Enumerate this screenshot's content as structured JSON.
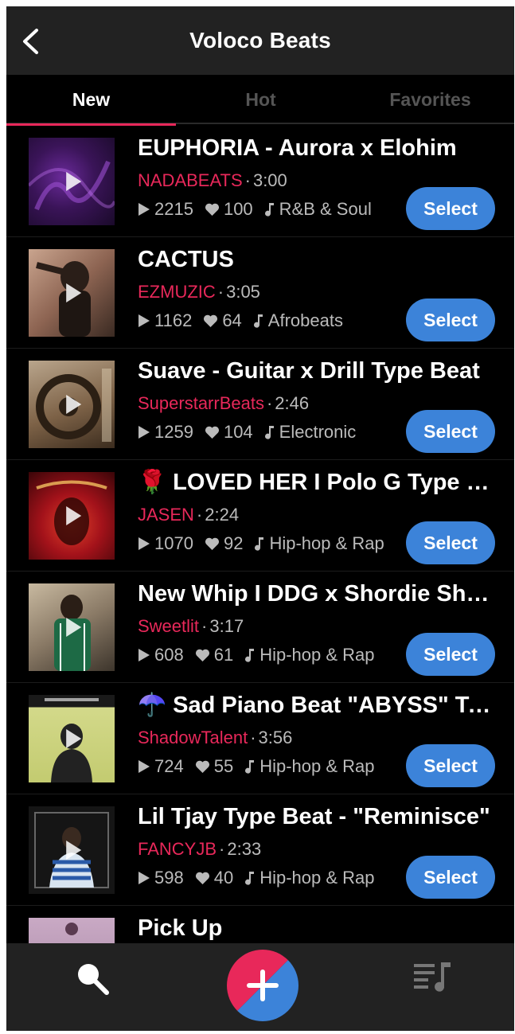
{
  "header": {
    "title": "Voloco Beats",
    "back_icon": "chevron-left-icon"
  },
  "tabs": [
    {
      "label": "New",
      "active": true
    },
    {
      "label": "Hot",
      "active": false
    },
    {
      "label": "Favorites",
      "active": false
    }
  ],
  "colors": {
    "accent": "#e8285a",
    "button": "#3c83d9",
    "bar": "#222222",
    "muted": "#bbbbbb"
  },
  "beats": [
    {
      "title": "EUPHORIA - Aurora x Elohim",
      "artist": "NADABEATS",
      "sep": "·",
      "duration": "3:00",
      "plays": "2215",
      "likes": "100",
      "genre": "R&B & Soul",
      "select_label": "Select"
    },
    {
      "title": "CACTUS",
      "artist": "EZMUZIC",
      "sep": "·",
      "duration": "3:05",
      "plays": "1162",
      "likes": "64",
      "genre": "Afrobeats",
      "select_label": "Select"
    },
    {
      "title": "Suave - Guitar x Drill Type Beat",
      "artist": "SuperstarrBeats",
      "sep": "·",
      "duration": "2:46",
      "plays": "1259",
      "likes": "104",
      "genre": "Electronic",
      "select_label": "Select"
    },
    {
      "title": "🌹 LOVED HER I Polo G Type Beat",
      "artist": "JASEN",
      "sep": "·",
      "duration": "2:24",
      "plays": "1070",
      "likes": "92",
      "genre": "Hip-hop & Rap",
      "select_label": "Select"
    },
    {
      "title": "New Whip I DDG x Shordie Shordie",
      "artist": "Sweetlit",
      "sep": "·",
      "duration": "3:17",
      "plays": "608",
      "likes": "61",
      "genre": "Hip-hop & Rap",
      "select_label": "Select"
    },
    {
      "title": "☂️ Sad Piano Beat \"ABYSS\" Type Beat",
      "artist": "ShadowTalent",
      "sep": "·",
      "duration": "3:56",
      "plays": "724",
      "likes": "55",
      "genre": "Hip-hop & Rap",
      "select_label": "Select"
    },
    {
      "title": "Lil Tjay Type Beat - \"Reminisce\"",
      "artist": "FANCYJB",
      "sep": "·",
      "duration": "2:33",
      "plays": "598",
      "likes": "40",
      "genre": "Hip-hop & Rap",
      "select_label": "Select"
    },
    {
      "title": "Pick Up",
      "artist": "",
      "sep": "",
      "duration": "",
      "plays": "",
      "likes": "",
      "genre": "",
      "select_label": ""
    }
  ],
  "bottom_nav": {
    "search_icon": "search-icon",
    "add_icon": "plus-icon",
    "queue_icon": "music-queue-icon"
  }
}
